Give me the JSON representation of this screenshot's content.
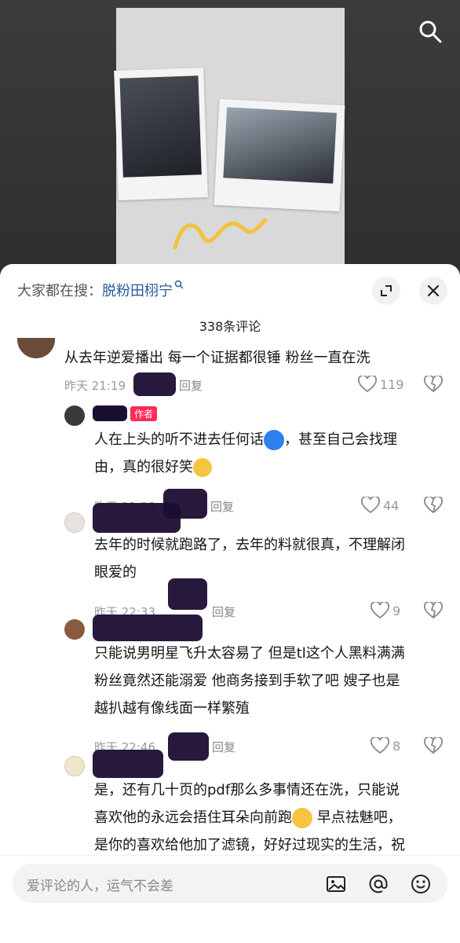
{
  "search_bar": {
    "prefix": "大家都在搜：",
    "keyword": "脱粉田栩宁"
  },
  "comment_count": "338条评论",
  "comments": [
    {
      "text": "从去年逆爱播出 每一个证据都很锤 粉丝一直在洗",
      "time": "昨天 21:19",
      "reply": "回复",
      "likes": "119"
    },
    {
      "author_badge": "作者",
      "text_1": "人在上头的听不进去任何话",
      "text_2": "，甚至自己会找理",
      "text_3": "由，真的很好笑",
      "time": "昨天 21:28",
      "reply": "回复",
      "likes": "44"
    },
    {
      "text_1": "去年的时候就跑路了，去年的料就很真，不理解闭",
      "text_2": "眼爱的",
      "time": "昨天 22:33",
      "reply": "回复",
      "likes": "9"
    },
    {
      "text_1": "只能说男明星飞升太容易了 但是tl这个人黑料满满",
      "text_2": "粉丝竟然还能溺爱 他商务接到手软了吧 嫂子也是",
      "text_3": "越扒越有像线面一样繁殖",
      "time": "昨天 22:46",
      "reply": "回复",
      "likes": "8"
    },
    {
      "text_1": "是，还有几十页的pdf那么多事情还在洗，只能说",
      "text_2": "喜欢他的永远会捂住耳朵向前跑",
      "text_2b": " 早点祛魅吧，",
      "text_3": "是你的喜欢给他加了滤镜，好好过现实的生活，祝"
    }
  ],
  "input": {
    "placeholder": "爱评论的人，运气不会差"
  },
  "colors": {
    "accent": "#fe2c55",
    "link": "#2a5a9c"
  }
}
